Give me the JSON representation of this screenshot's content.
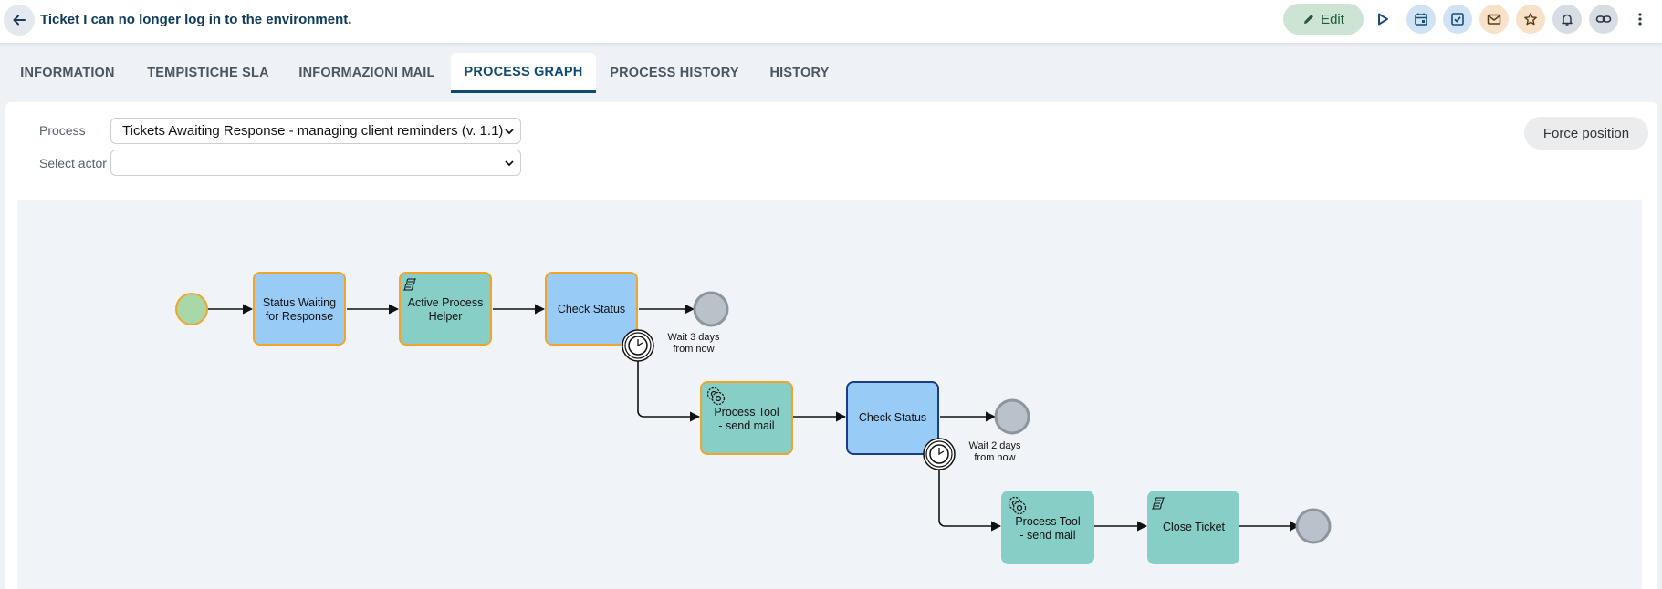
{
  "header": {
    "title": "Ticket I can no longer log in to the environment.",
    "edit_label": "Edit",
    "icons": [
      "arrow-left-icon",
      "pencil-icon",
      "play-icon",
      "calendar-icon",
      "checkbox-icon",
      "mail-icon",
      "star-icon",
      "bell-icon",
      "link-icon",
      "more-vertical-icon"
    ]
  },
  "tabs": [
    {
      "label": "INFORMATION"
    },
    {
      "label": "TEMPISTICHE SLA"
    },
    {
      "label": "INFORMAZIONI MAIL"
    },
    {
      "label": "PROCESS GRAPH",
      "active": true
    },
    {
      "label": "PROCESS HISTORY"
    },
    {
      "label": "HISTORY"
    }
  ],
  "form": {
    "process_label": "Process",
    "process_value": "Tickets Awaiting Response - managing client reminders (v. 1.1)",
    "actor_label": "Select actor",
    "actor_value": "",
    "force_label": "Force position"
  },
  "graph": {
    "nodes": {
      "status_waiting": {
        "line1": "Status Waiting",
        "line2": "for Response"
      },
      "active_helper": {
        "line1": "Active Process",
        "line2": "Helper"
      },
      "check_status_1": {
        "label": "Check Status"
      },
      "timer_1": {
        "line1": "Wait 3 days",
        "line2": "from now"
      },
      "tool_1": {
        "line1": "Process Tool",
        "line2": "- send mail"
      },
      "check_status_2": {
        "label": "Check Status"
      },
      "timer_2": {
        "line1": "Wait 2 days",
        "line2": "from now"
      },
      "tool_2": {
        "line1": "Process Tool",
        "line2": "- send mail"
      },
      "close_ticket": {
        "label": "Close Ticket"
      }
    },
    "colors": {
      "task_blue": "#99cbf7",
      "script_teal": "#86cec6",
      "highlight_orange": "#f0a52a",
      "active_border": "#1b3c8c",
      "start_green": "#a8d8a8",
      "end_gray": "#b9c1c9"
    }
  }
}
